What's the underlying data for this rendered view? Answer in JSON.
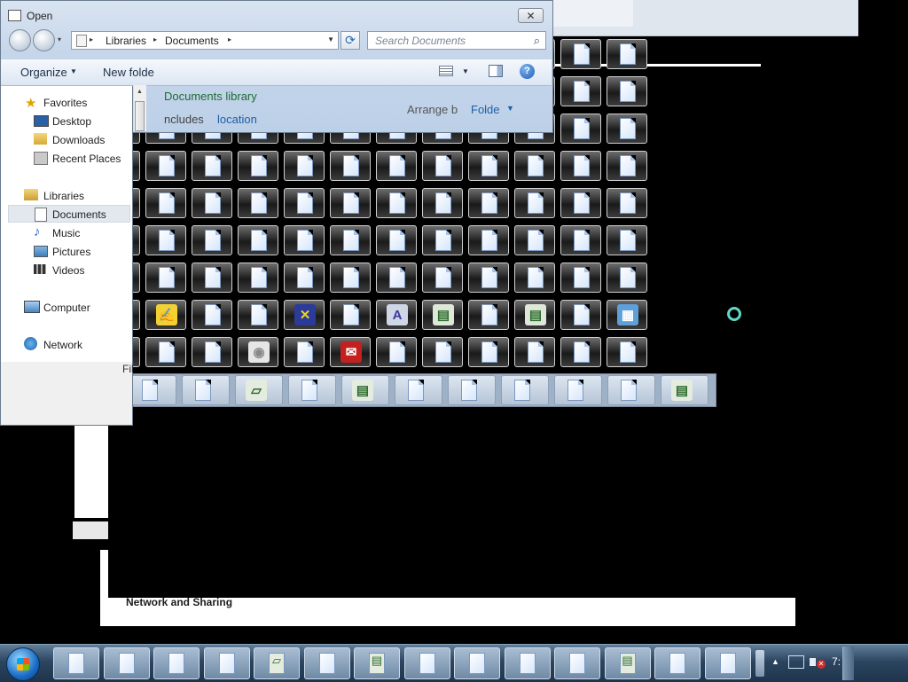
{
  "dialog": {
    "title": "Open",
    "close_glyph": "✕",
    "address": {
      "segments": [
        "Libraries",
        "Documents"
      ],
      "separator": "▸"
    },
    "search": {
      "placeholder": "Search Documents"
    },
    "toolbar": {
      "organize": "Organize",
      "new_folder": "New folde"
    },
    "nav": {
      "favorites_header": "Favorites",
      "favorites": [
        "Desktop",
        "Downloads",
        "Recent Places"
      ],
      "libraries_header": "Libraries",
      "libraries": [
        "Documents",
        "Music",
        "Pictures",
        "Videos"
      ],
      "computer": "Computer",
      "network": "Network"
    },
    "library_header": {
      "title": "Documents library",
      "includes": "ncludes",
      "location_link": "location",
      "arrange_label": "Arrange b",
      "arrange_value": "Folde"
    },
    "file_name_label": "Fil"
  },
  "background": {
    "network_text": "Network and Sharing"
  },
  "colors": {
    "library_title": "#1e6b2e",
    "link": "#1d5fa8",
    "taskbar": "#2c4560"
  },
  "taskbar": {
    "clock": "7:"
  }
}
